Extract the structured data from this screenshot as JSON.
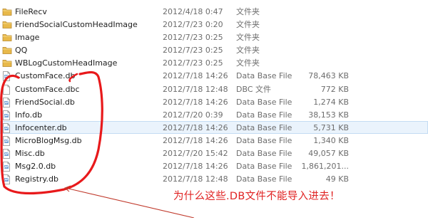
{
  "files": [
    {
      "name": "FileRecv",
      "date": "2012/4/18 0:47",
      "type": "文件夹",
      "size": "",
      "kind": "folder"
    },
    {
      "name": "FriendSocialCustomHeadImage",
      "date": "2012/7/23 0:20",
      "type": "文件夹",
      "size": "",
      "kind": "folder"
    },
    {
      "name": "Image",
      "date": "2012/7/23 0:25",
      "type": "文件夹",
      "size": "",
      "kind": "folder"
    },
    {
      "name": "QQ",
      "date": "2012/7/23 0:25",
      "type": "文件夹",
      "size": "",
      "kind": "folder"
    },
    {
      "name": "WBLogCustomHeadImage",
      "date": "2012/7/23 0:25",
      "type": "文件夹",
      "size": "",
      "kind": "folder"
    },
    {
      "name": "CustomFace.db",
      "date": "2012/7/18 14:26",
      "type": "Data Base File",
      "size": "78,463 KB",
      "kind": "db"
    },
    {
      "name": "CustomFace.dbc",
      "date": "2012/7/18 12:48",
      "type": "DBC 文件",
      "size": "772 KB",
      "kind": "file"
    },
    {
      "name": "FriendSocial.db",
      "date": "2012/7/18 14:26",
      "type": "Data Base File",
      "size": "1,274 KB",
      "kind": "db"
    },
    {
      "name": "Info.db",
      "date": "2012/7/20 0:39",
      "type": "Data Base File",
      "size": "38,153 KB",
      "kind": "db"
    },
    {
      "name": "Infocenter.db",
      "date": "2012/7/18 14:26",
      "type": "Data Base File",
      "size": "5,731 KB",
      "kind": "db",
      "hovered": true
    },
    {
      "name": "MicroBlogMsg.db",
      "date": "2012/7/18 14:26",
      "type": "Data Base File",
      "size": "1,340 KB",
      "kind": "db"
    },
    {
      "name": "Misc.db",
      "date": "2012/7/20 15:42",
      "type": "Data Base File",
      "size": "49,057 KB",
      "kind": "db"
    },
    {
      "name": "Msg2.0.db",
      "date": "2012/7/18 14:26",
      "type": "Data Base File",
      "size": "1,861,201...",
      "kind": "db"
    },
    {
      "name": "Registry.db",
      "date": "2012/7/18 12:48",
      "type": "Data Base File",
      "size": "49 KB",
      "kind": "db"
    }
  ],
  "annotation": {
    "text": "为什么这些.DB文件不能导入进去！",
    "color": "#e02222"
  },
  "colors": {
    "folder": "#e8b94a",
    "hover_bg": "#eaf3fc",
    "hover_border": "#c4dcf3"
  }
}
